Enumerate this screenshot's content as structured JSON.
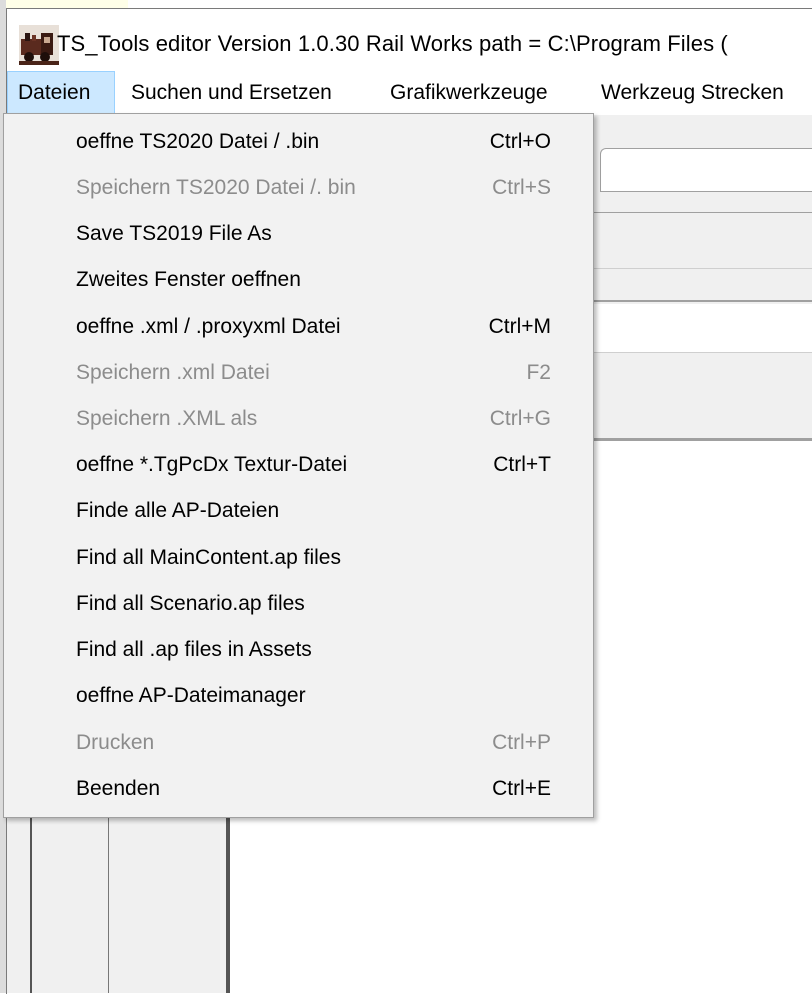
{
  "window": {
    "title": "TS_Tools editor  Version 1.0.30   Rail Works path = C:\\Program Files (",
    "icon": "locomotive-app-icon"
  },
  "menubar": {
    "items": [
      {
        "label": "Dateien",
        "active": true
      },
      {
        "label": "Suchen und Ersetzen"
      },
      {
        "label": "Grafikwerkzeuge"
      },
      {
        "label": "Werkzeug Strecken"
      }
    ]
  },
  "dropdown": {
    "items": [
      {
        "label": "oeffne TS2020 Datei / .bin",
        "shortcut": "Ctrl+O",
        "enabled": true
      },
      {
        "label": "Speichern TS2020 Datei /. bin",
        "shortcut": "Ctrl+S",
        "enabled": false
      },
      {
        "label": "Save TS2019 File As",
        "shortcut": "",
        "enabled": true
      },
      {
        "label": "Zweites Fenster oeffnen",
        "shortcut": "",
        "enabled": true
      },
      {
        "label": "oeffne .xml / .proxyxml Datei",
        "shortcut": "Ctrl+M",
        "enabled": true
      },
      {
        "label": "Speichern .xml Datei",
        "shortcut": "F2",
        "enabled": false
      },
      {
        "label": "Speichern .XML als",
        "shortcut": "Ctrl+G",
        "enabled": false
      },
      {
        "label": "oeffne *.TgPcDx Textur-Datei",
        "shortcut": "Ctrl+T",
        "enabled": true
      },
      {
        "label": "Finde alle AP-Dateien",
        "shortcut": "",
        "enabled": true
      },
      {
        "label": "Find all MainContent.ap files",
        "shortcut": "",
        "enabled": true
      },
      {
        "label": "Find all Scenario.ap files",
        "shortcut": "",
        "enabled": true
      },
      {
        "label": "Find all .ap files in Assets",
        "shortcut": "",
        "enabled": true
      },
      {
        "label": "oeffne AP-Dateimanager",
        "shortcut": "",
        "enabled": true
      },
      {
        "label": "Drucken",
        "shortcut": "Ctrl+P",
        "enabled": false
      },
      {
        "label": "Beenden",
        "shortcut": "Ctrl+E",
        "enabled": true
      }
    ]
  },
  "colors": {
    "menu_bg": "#f2f2f2",
    "menu_active_bg": "#cce8ff",
    "disabled_text": "#8c8c8c"
  }
}
